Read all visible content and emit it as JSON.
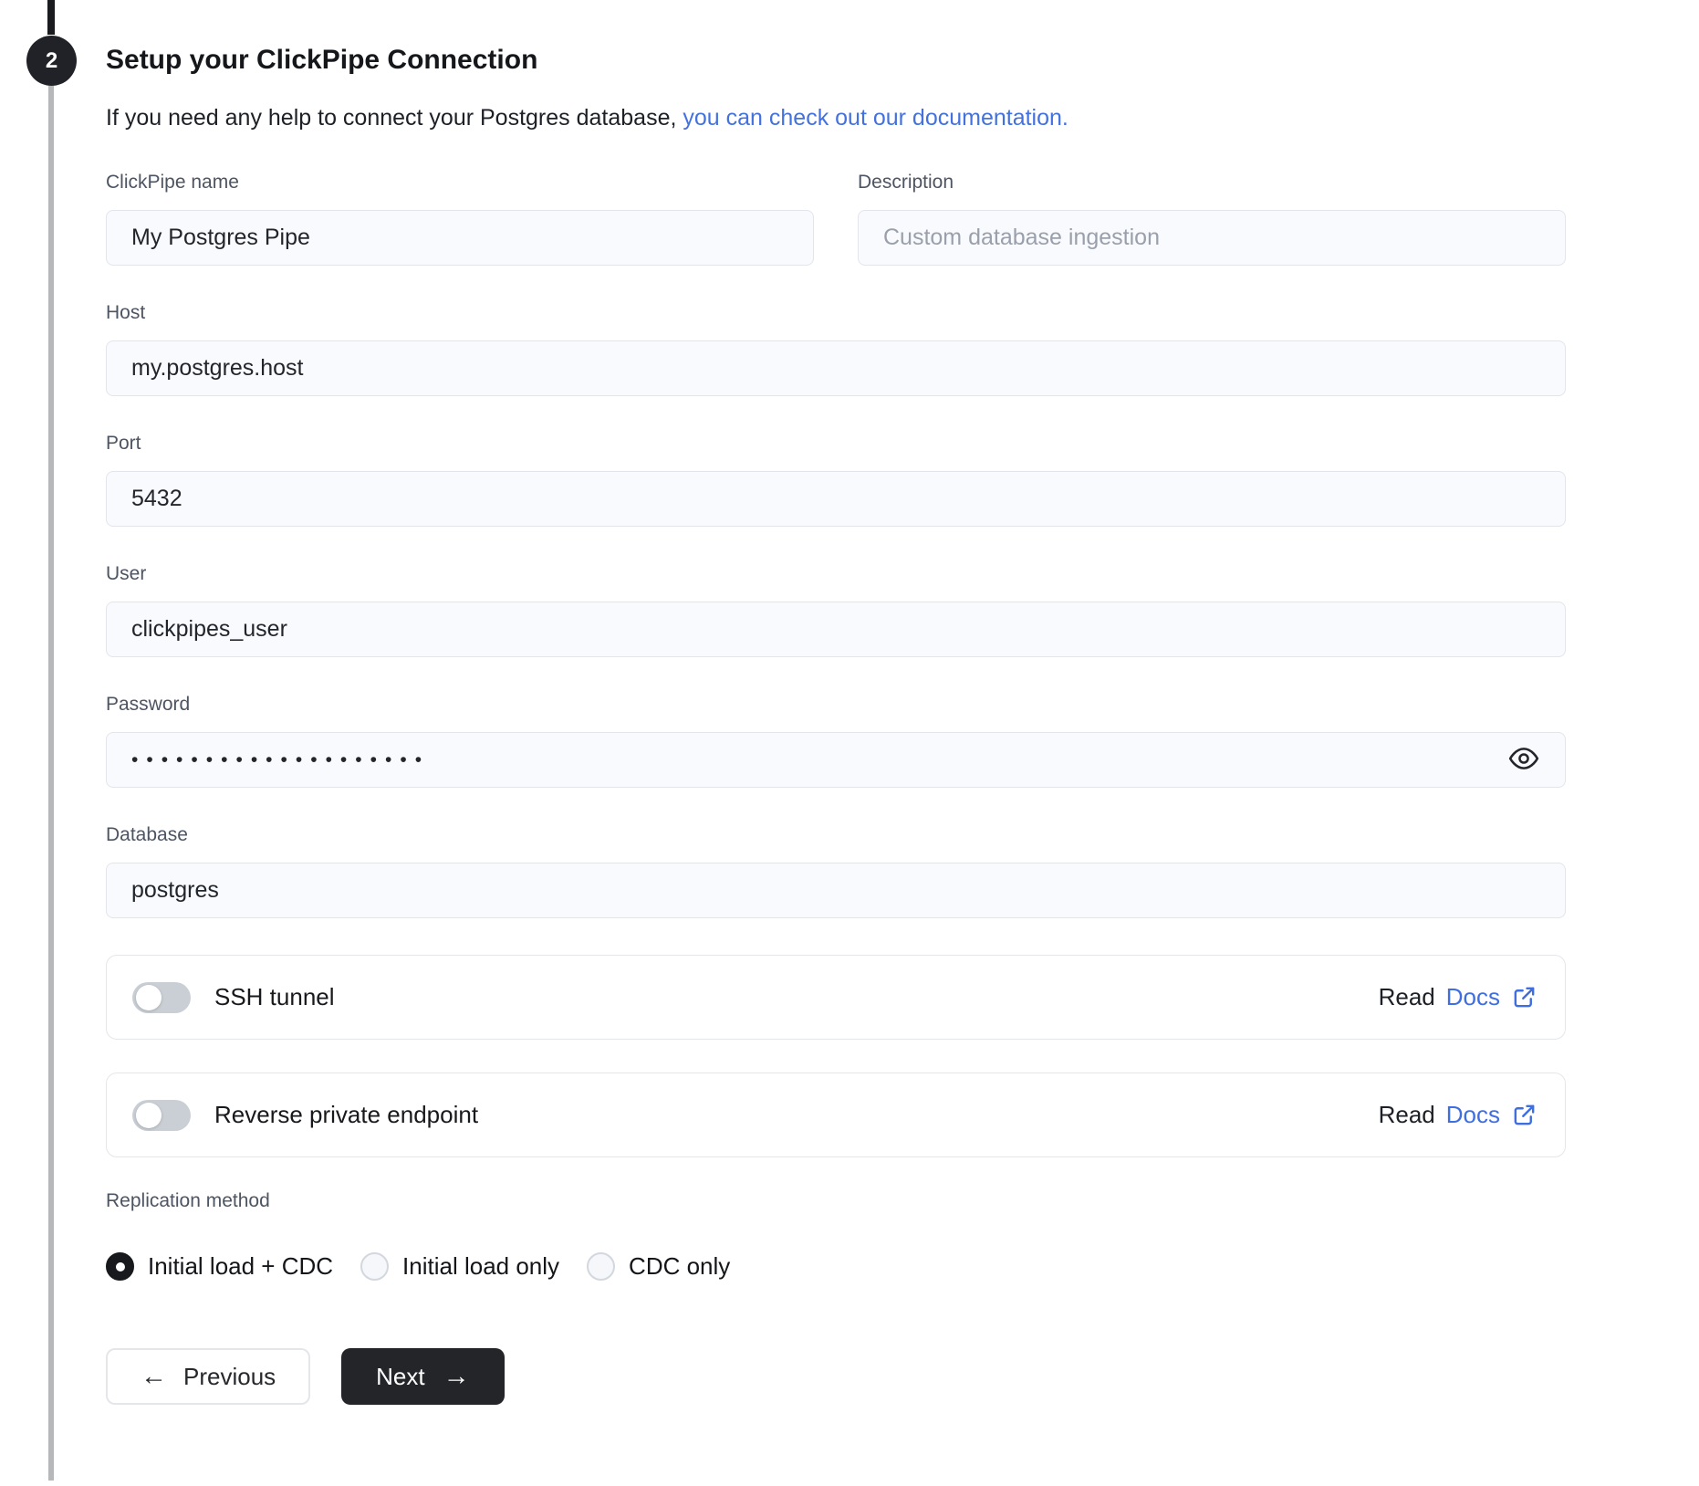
{
  "colors": {
    "link_blue": "#4372de",
    "docs_blue": "#3e6ee0",
    "badge_dark": "#202227",
    "next_button_dark": "#232529"
  },
  "step": {
    "number": "2",
    "title": "Setup your ClickPipe Connection",
    "intro_text": "If you need any help to connect your Postgres database,",
    "intro_link": "you can check out our documentation."
  },
  "form": {
    "clickpipe_name": {
      "label": "ClickPipe name",
      "value": "My Postgres Pipe"
    },
    "description": {
      "label": "Description",
      "placeholder": "Custom database ingestion"
    },
    "host": {
      "label": "Host",
      "value": "my.postgres.host"
    },
    "port": {
      "label": "Port",
      "value": "5432"
    },
    "user": {
      "label": "User",
      "value": "clickpipes_user"
    },
    "password": {
      "label": "Password",
      "masked_value": "••••••••••••••••••••"
    },
    "database": {
      "label": "Database",
      "value": "postgres"
    }
  },
  "toggle_rows": [
    {
      "label": "SSH tunnel",
      "state": "off",
      "read_text": "Read",
      "docs_link_text": "Docs"
    },
    {
      "label": "Reverse private endpoint",
      "state": "off",
      "read_text": "Read",
      "docs_link_text": "Docs"
    }
  ],
  "replication": {
    "label": "Replication method",
    "options": [
      {
        "label": "Initial load + CDC",
        "selected": true
      },
      {
        "label": "Initial load only",
        "selected": false
      },
      {
        "label": "CDC only",
        "selected": false
      }
    ]
  },
  "buttons": {
    "previous": "Previous",
    "next": "Next",
    "previous_arrow": "←",
    "next_arrow": "→"
  }
}
